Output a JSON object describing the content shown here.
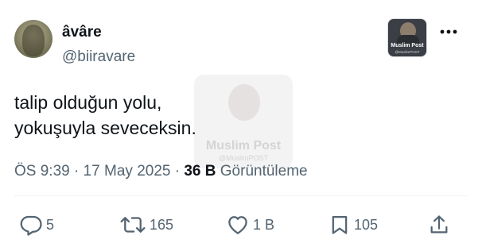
{
  "tweet": {
    "author": {
      "display_name": "âvâre",
      "handle": "@biiravare"
    },
    "text_lines": [
      "talip olduğun yolu,",
      "yokuşuyla seveceksin."
    ],
    "badge": {
      "name": "Muslim Post",
      "handle": "@MuslimPOST"
    },
    "watermark": {
      "name": "Muslim Post",
      "handle": "@MuslimPOST"
    },
    "meta": {
      "time": "ÖS 9:39",
      "separator": "·",
      "date": "17 May 2025",
      "views_count": "36 B",
      "views_label": "Görüntüleme"
    },
    "actions": {
      "replies": "5",
      "reposts": "165",
      "likes": "1 B",
      "bookmarks": "105"
    },
    "icons": {
      "reply": "reply-icon",
      "repost": "repost-icon",
      "like": "heart-icon",
      "bookmark": "bookmark-icon",
      "share": "share-icon",
      "more": "more-options-icon"
    },
    "colors": {
      "text_primary": "#0f1419",
      "text_secondary": "#536471",
      "divider": "#eff3f4"
    }
  }
}
